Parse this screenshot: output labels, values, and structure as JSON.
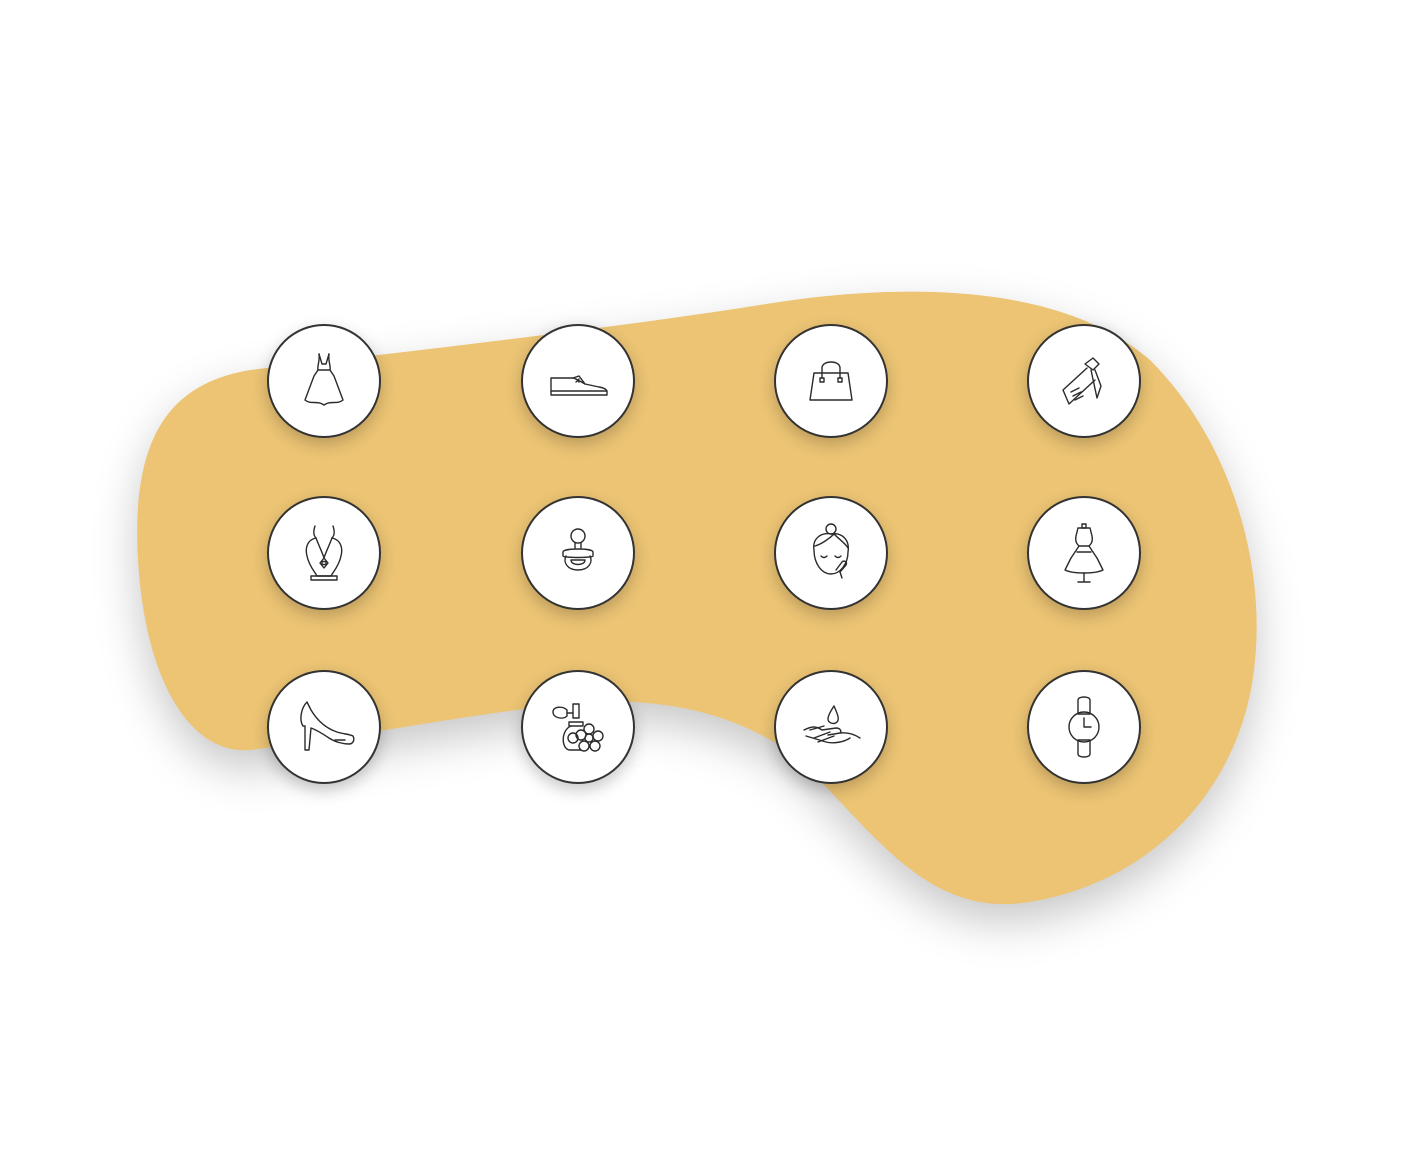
{
  "background": {
    "color": "#ffffff",
    "blob_color": "#ecc474"
  },
  "tile": {
    "fill": "#ffffff",
    "border": "#333333",
    "icon_stroke": "#2a2a2a"
  },
  "icons": [
    {
      "name": "dress-icon"
    },
    {
      "name": "shoe-icon"
    },
    {
      "name": "handbag-icon"
    },
    {
      "name": "tie-icon"
    },
    {
      "name": "necklace-icon"
    },
    {
      "name": "pacifier-icon"
    },
    {
      "name": "facial-care-icon"
    },
    {
      "name": "mannequin-dress-icon"
    },
    {
      "name": "high-heel-icon"
    },
    {
      "name": "perfume-icon"
    },
    {
      "name": "hand-lotion-icon"
    },
    {
      "name": "wristwatch-icon"
    }
  ]
}
